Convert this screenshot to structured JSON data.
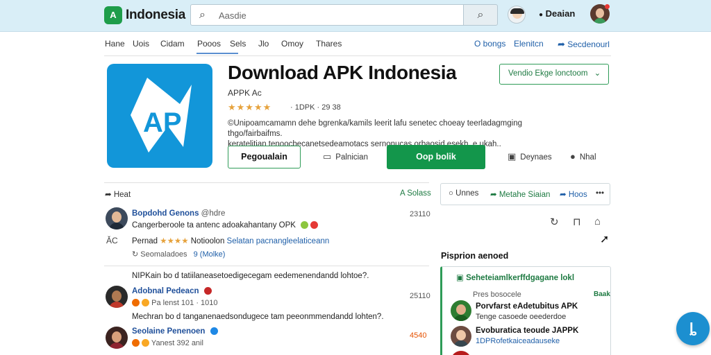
{
  "header": {
    "logo_mark": "A",
    "logo_text": "Indonesia",
    "search_placeholder": "Aasdie",
    "search_icon": "search-icon",
    "user_name": "Deaian",
    "user_prefix": "●"
  },
  "nav": {
    "items": [
      "Hane",
      "Uois",
      "Cidam",
      "Pooos",
      "Sels",
      "Jlo",
      "Omoy",
      "Thares"
    ],
    "active_index": 3,
    "right": [
      "O bongs",
      "Elenitcn",
      "Secdenourl"
    ]
  },
  "app": {
    "title": "Download APK Indonesia",
    "developer": "APPK Ac",
    "rating_stars": "★★★★★",
    "stats": "· 1DPK · 29 38",
    "description_line1": "©Unipoamcamamn dehe bgrenka/kamils leerit lafu senetec choeay teerladagmging thgo/fairbaifms.",
    "description_line2": "keratelitian tenoocbecanetsedeamotacs sernonucas orbaosid esekh, e ukah..",
    "version_select": "Vendio Ekge lonctoom",
    "btn_outline": "Pegoualain",
    "btn_primary": "Oop bolik",
    "action_1": "Palnician",
    "action_2": "Deynaes",
    "action_3": "Nhal",
    "icon_letters": "AP",
    "accent_green": "#13964b",
    "accent_blue": "#1296d9"
  },
  "comments": {
    "header_left": "Heat",
    "header_right": "A Solass",
    "items": [
      {
        "name": "Bopdohd Genons",
        "handle": "@hdre",
        "time": "23110",
        "text": "Cangerberoole ta antenc adoakahantany OPK",
        "sub_label": "Pernad",
        "sub_stars": "★★★★",
        "sub_text": "Notioolon",
        "sub_link": "Selatan pacnangleelaticeann",
        "meta": "Seomaladoes",
        "meta_link": "9 (Molke)"
      },
      {
        "question": "NIPKain bo d tatiilaneasetoedigecegam eedemenendandd lohtoe?.",
        "name": "Adobnal Pedeacn",
        "time": "25110",
        "meta": "Pa lenst 101 · 1010"
      },
      {
        "question": "Mechran bo d tanganenaedsondugece tam peeonmmendandd lohten?.",
        "name": "Seolaine Penenoen",
        "time": "4540",
        "meta": "Yanest 392 anil"
      }
    ],
    "left_avatar_label": "ǍC"
  },
  "sidebar": {
    "tabs": [
      "Unnes",
      "Metahe Siaian",
      "Hoos"
    ],
    "more": "•••",
    "title": "Pisprion aenoed",
    "box_header": "Seheteiamlkerffdgagane lokl",
    "box_sub": "Pres bosocele",
    "box_tag": "Baak",
    "items": [
      {
        "name": "Porvfarst eAdetubitus APK",
        "sub": "Tenge casoede oeederdoe"
      },
      {
        "name": "Evoburatica teoude JAPPK",
        "sub": "1DPRofetkaiceadauseke"
      }
    ]
  },
  "fab_label": "ȴ"
}
